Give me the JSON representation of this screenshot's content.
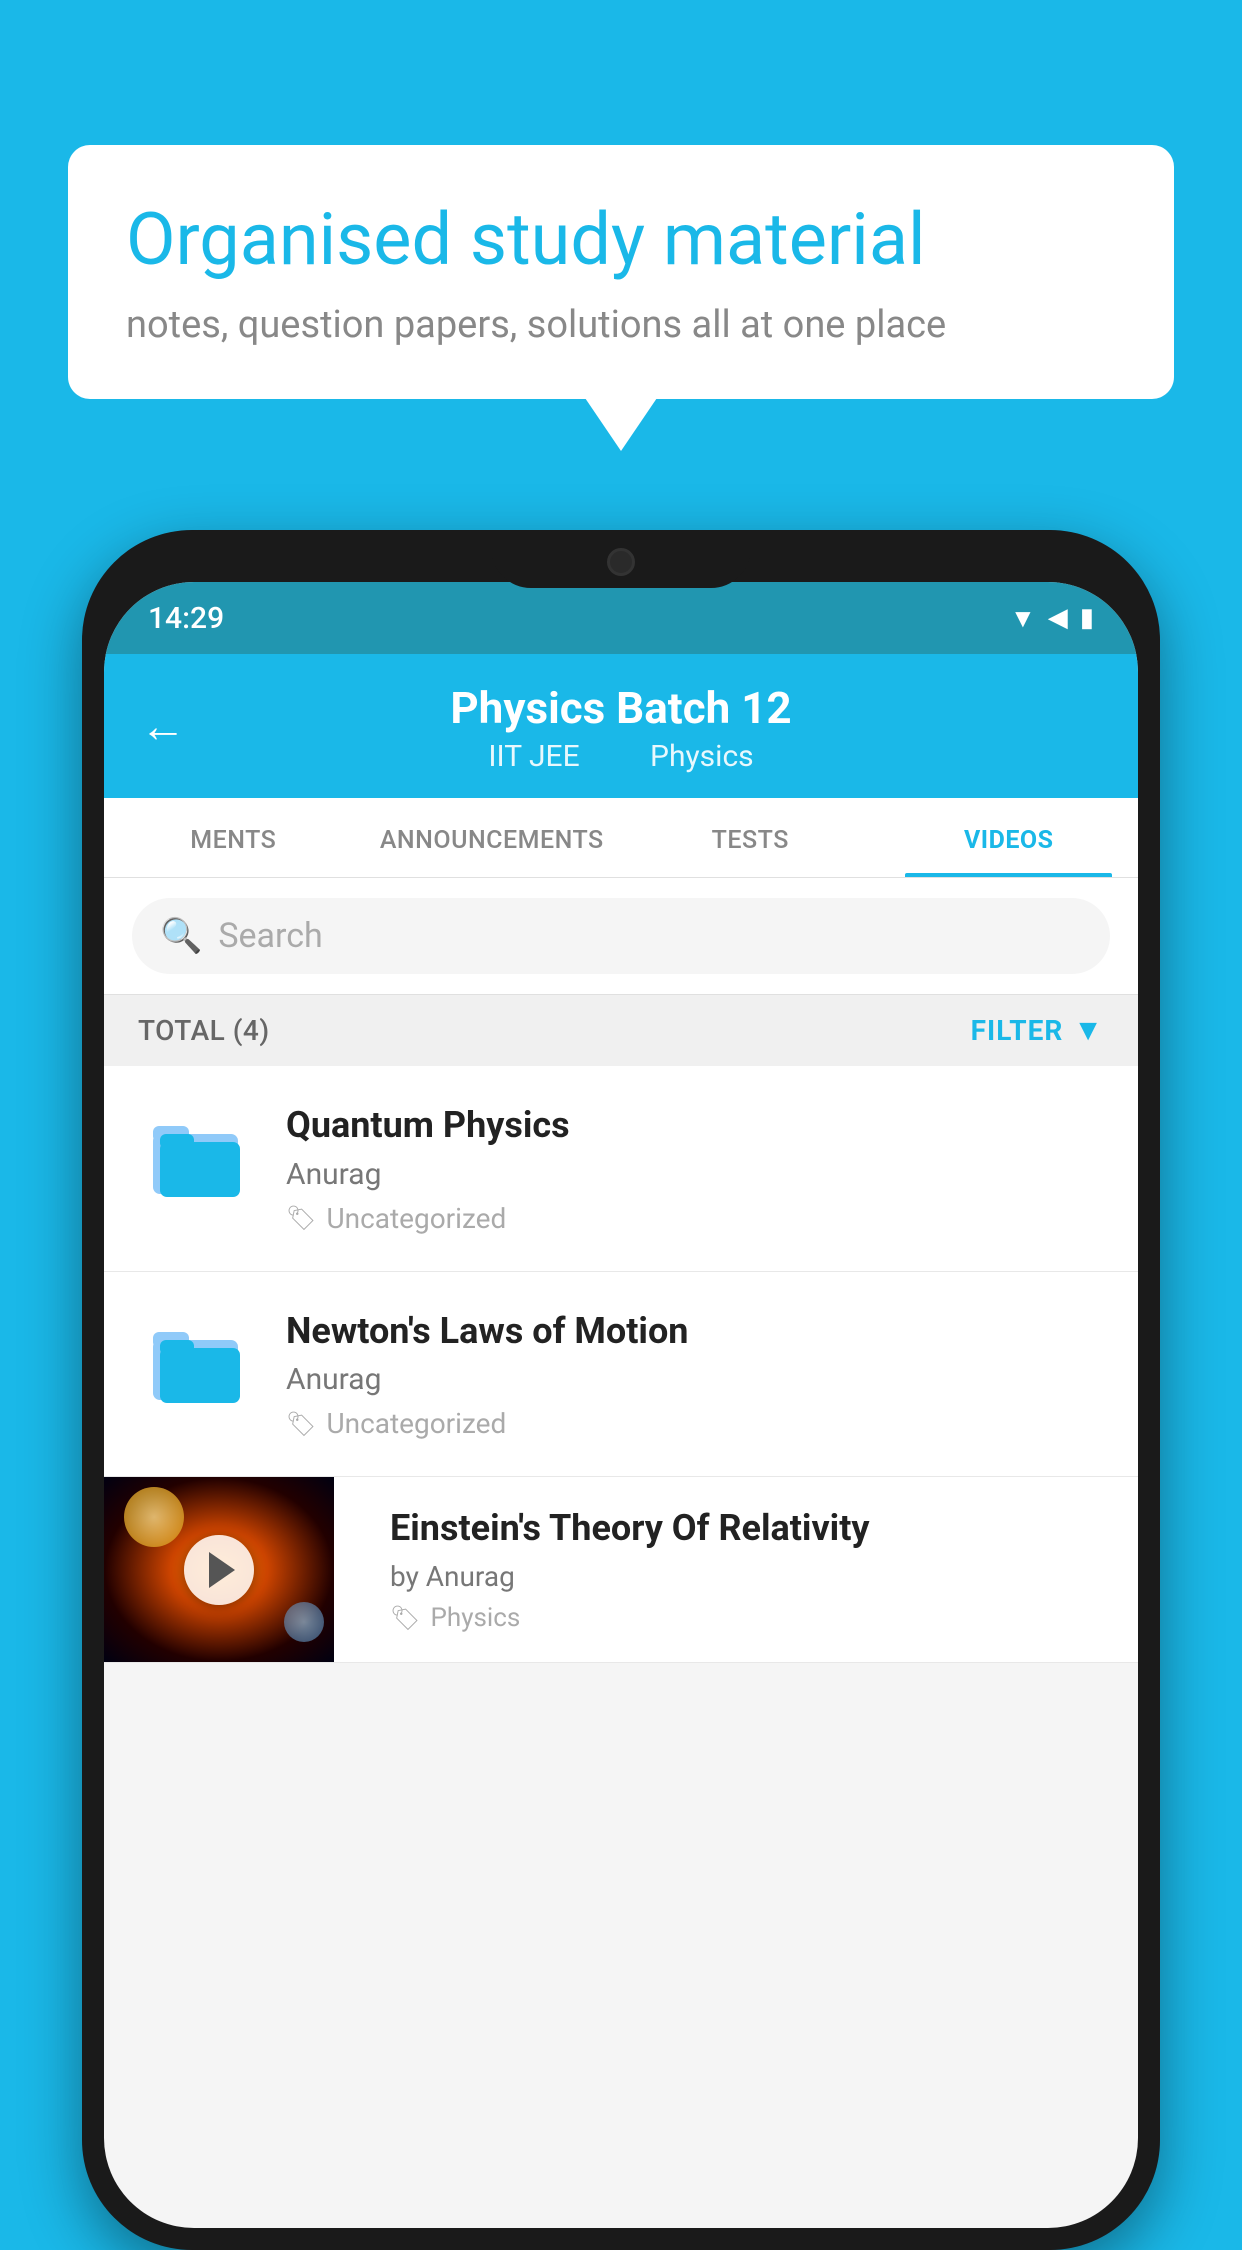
{
  "background_color": "#1ab8e8",
  "bubble": {
    "title": "Organised study material",
    "subtitle": "notes, question papers, solutions all at one place"
  },
  "status_bar": {
    "time": "14:29"
  },
  "header": {
    "title": "Physics Batch 12",
    "subtitle_part1": "IIT JEE",
    "subtitle_part2": "Physics"
  },
  "tabs": [
    {
      "label": "MENTS",
      "active": false
    },
    {
      "label": "ANNOUNCEMENTS",
      "active": false
    },
    {
      "label": "TESTS",
      "active": false
    },
    {
      "label": "VIDEOS",
      "active": true
    }
  ],
  "search": {
    "placeholder": "Search"
  },
  "filter_bar": {
    "total_label": "TOTAL (4)",
    "filter_label": "FILTER"
  },
  "videos": [
    {
      "id": 1,
      "title": "Quantum Physics",
      "author": "Anurag",
      "tag": "Uncategorized",
      "has_thumbnail": false
    },
    {
      "id": 2,
      "title": "Newton's Laws of Motion",
      "author": "Anurag",
      "tag": "Uncategorized",
      "has_thumbnail": false
    },
    {
      "id": 3,
      "title": "Einstein's Theory Of Relativity",
      "author": "by Anurag",
      "tag": "Physics",
      "has_thumbnail": true
    }
  ]
}
